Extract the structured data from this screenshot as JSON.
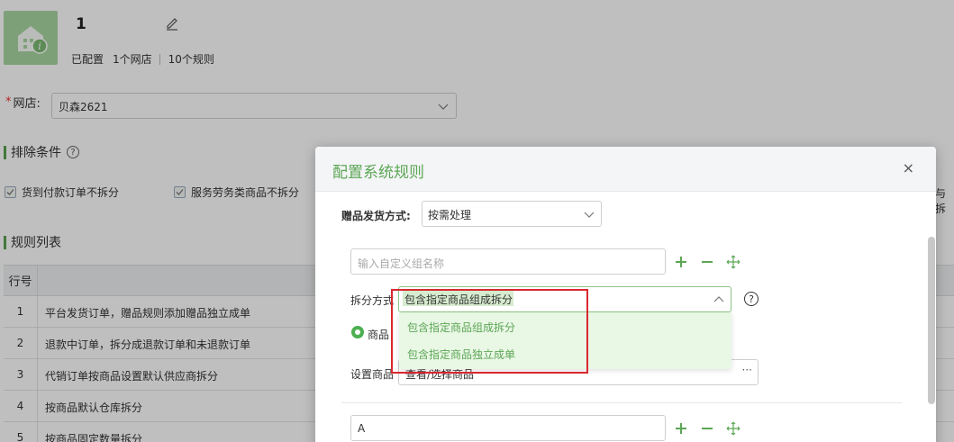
{
  "shop": {
    "name": "1",
    "status": "已配置",
    "shop_count": "1个网店",
    "rule_count": "10个规则"
  },
  "shop_field": {
    "required_mark": "*",
    "label": "网店:",
    "value": "贝森2621"
  },
  "exclusion": {
    "title": "排除条件",
    "help": "?",
    "options": [
      {
        "label": "货到付款订单不拆分",
        "checked": true
      },
      {
        "label": "服务劳务类商品不拆分",
        "checked": true
      }
    ],
    "truncated_tail": "与拆"
  },
  "rule_list": {
    "title": "规则列表",
    "header_index": "行号",
    "rows": [
      {
        "index": "1",
        "text": "平台发货订单，赠品规则添加赠品独立成单"
      },
      {
        "index": "2",
        "text": "退款中订单，拆分成退款订单和未退款订单"
      },
      {
        "index": "3",
        "text": "代销订单按商品设置默认供应商拆分"
      },
      {
        "index": "4",
        "text": "按商品默认仓库拆分"
      },
      {
        "index": "5",
        "text": "按商品固定数量拆分"
      }
    ]
  },
  "modal": {
    "title": "配置系统规则",
    "close": "×",
    "gift_label": "赠品发货方式:",
    "gift_value": "按需处理",
    "group_name_placeholder": "输入自定义组名称",
    "split_label": "拆分方式",
    "split_value": "包含指定商品组成拆分",
    "split_help": "?",
    "radio_label": "商品",
    "set_goods_label": "设置商品",
    "set_goods_value": "查看/选择商品",
    "ellipsis": "···",
    "group2_value": "A",
    "dropdown_options": [
      "包含指定商品组成拆分",
      "包含指定商品独立成单"
    ]
  },
  "colors": {
    "accent": "#5ca655",
    "highlight_border": "#d8282f",
    "dropdown_bg": "#e9f7e5"
  }
}
